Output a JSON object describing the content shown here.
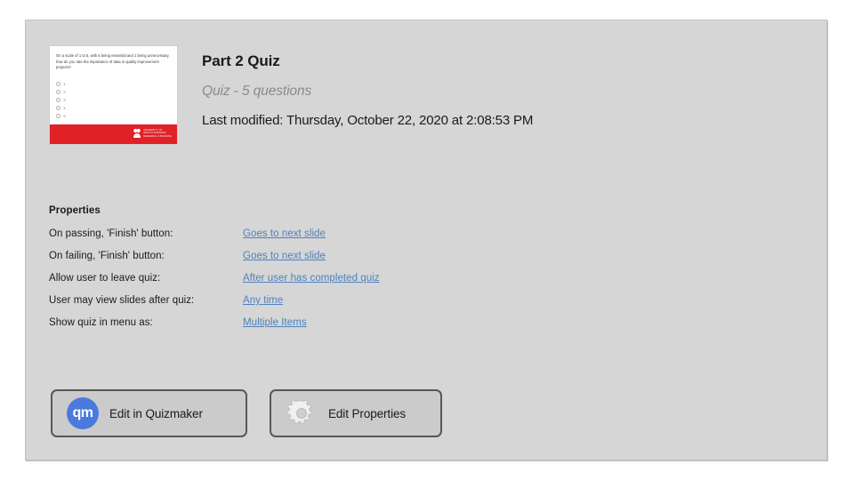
{
  "panel": {
    "background_color": "#d6d6d6"
  },
  "header": {
    "title": "Part 2 Quiz",
    "subtitle": "Quiz - 5 questions",
    "last_modified": "Last modified: Thursday, October 22, 2020 at 2:08:53 PM"
  },
  "thumbnail": {
    "question": "On a scale of 1 to 5, with 5 being essential and 1 being unnecessary, how do you rate the importance of data in quality improvement projects?",
    "options": [
      "1",
      "2",
      "3",
      "4",
      "5"
    ],
    "footer_color": "#e02128",
    "logo_text": "UNIVERSITY OF\nHEALTH SCIENCES\nRESEARCH & TRAINING"
  },
  "properties": {
    "heading": "Properties",
    "rows": [
      {
        "label": "On passing, 'Finish' button:",
        "value": "Goes to next slide"
      },
      {
        "label": "On failing, 'Finish' button:",
        "value": "Goes to next slide"
      },
      {
        "label": "Allow user to leave quiz:",
        "value": "After user has completed quiz"
      },
      {
        "label": "User may view slides after quiz:",
        "value": "Any time"
      },
      {
        "label": "Show quiz in menu as:",
        "value": "Multiple Items"
      }
    ],
    "link_color": "#4f81bd"
  },
  "buttons": {
    "edit_quizmaker": {
      "label": "Edit in Quizmaker",
      "icon": "quizmaker-icon",
      "icon_text": "qm",
      "icon_color": "#4a7ade"
    },
    "edit_properties": {
      "label": "Edit Properties",
      "icon": "gear-icon"
    }
  }
}
